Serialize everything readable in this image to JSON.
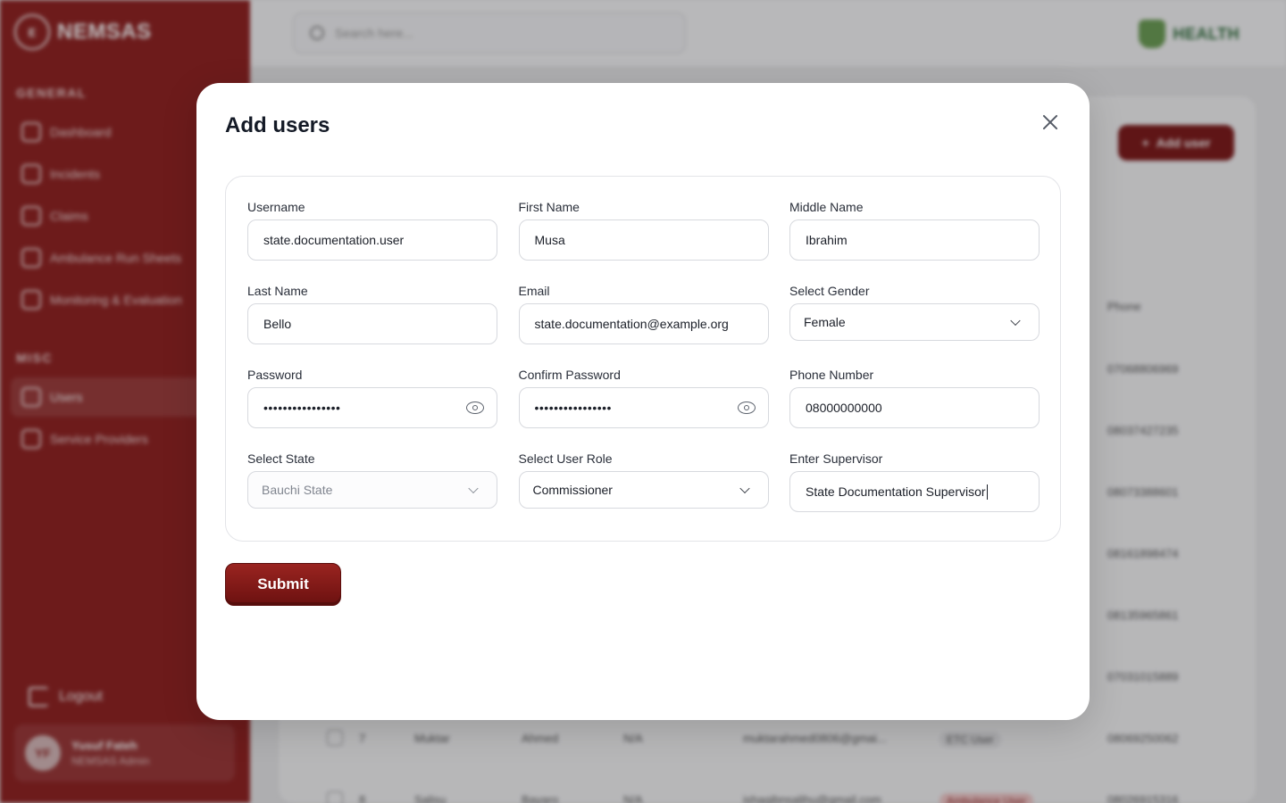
{
  "app": {
    "brand": "NEMSAS",
    "brand_logo_text": "E",
    "search_placeholder": "Search here...",
    "health_logo_text": "HEALTH",
    "sidebar": {
      "general_title": "GENERAL",
      "general_items": [
        "Dashboard",
        "Incidents",
        "Claims",
        "Ambulance Run Sheets",
        "Monitoring & Evaluation"
      ],
      "misc_title": "MISC",
      "misc_items": [
        "Users",
        "Service Providers"
      ],
      "logout": "Logout",
      "profile": {
        "initials": "YF",
        "name": "Yusuf Fateh",
        "role": "NEMSAS Admin"
      }
    },
    "add_user_button": "Add user",
    "table_header": {
      "phone": "Phone"
    },
    "phones": [
      "07068806969",
      "08037427235",
      "08073388601",
      "08161898474",
      "08135965861",
      "07031015889"
    ],
    "rows": [
      {
        "num": "7",
        "first": "Muktar",
        "last": "Ahmed",
        "middle": "N/A",
        "email": "muktarahmed0806@gmai...",
        "role": "ETC User",
        "phone": "08069250062"
      },
      {
        "num": "8",
        "first": "Salisu",
        "last": "Bayaro",
        "middle": "N/A",
        "email": "ishaqibnsalihu@gmail.com",
        "role": "Ambulance User",
        "phone": "08026915316"
      }
    ]
  },
  "modal": {
    "title": "Add users",
    "fields": {
      "username": {
        "label": "Username",
        "value": "state.documentation.user"
      },
      "first_name": {
        "label": "First Name",
        "value": "Musa"
      },
      "middle_name": {
        "label": "Middle Name",
        "value": "Ibrahim"
      },
      "last_name": {
        "label": "Last Name",
        "value": "Bello"
      },
      "email": {
        "label": "Email",
        "value": "state.documentation@example.org"
      },
      "gender": {
        "label": "Select Gender",
        "value": "Female"
      },
      "password": {
        "label": "Password",
        "value": "••••••••••••••••"
      },
      "confirm_password": {
        "label": "Confirm Password",
        "value": "••••••••••••••••"
      },
      "phone": {
        "label": "Phone Number",
        "value": "08000000000"
      },
      "state": {
        "label": "Select State",
        "value": "Bauchi State"
      },
      "user_role": {
        "label": "Select User Role",
        "value": "Commissioner"
      },
      "supervisor": {
        "label": "Enter Supervisor",
        "value": "State Documentation Supervisor"
      }
    },
    "submit_label": "Submit"
  }
}
